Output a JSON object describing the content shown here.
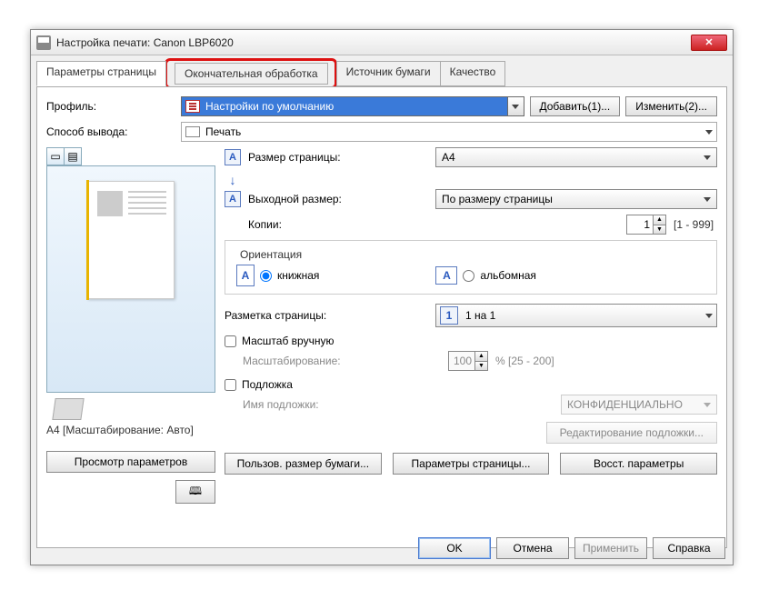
{
  "title": "Настройка печати: Canon LBP6020",
  "tabs": [
    "Параметры страницы",
    "Окончательная обработка",
    "Источник бумаги",
    "Качество"
  ],
  "profile": {
    "label": "Профиль:",
    "value": "Настройки по умолчанию",
    "add": "Добавить(1)...",
    "edit": "Изменить(2)..."
  },
  "output": {
    "label": "Способ вывода:",
    "value": "Печать"
  },
  "page_size": {
    "label": "Размер страницы:",
    "value": "A4"
  },
  "output_size": {
    "label": "Выходной размер:",
    "value": "По размеру страницы"
  },
  "copies": {
    "label": "Копии:",
    "value": "1",
    "range": "[1 - 999]"
  },
  "orientation": {
    "legend": "Ориентация",
    "portrait": "книжная",
    "landscape": "альбомная"
  },
  "layout": {
    "label": "Разметка страницы:",
    "value": "1 на 1"
  },
  "manual_scale": {
    "label": "Масштаб вручную",
    "scaling_label": "Масштабирование:",
    "value": "100",
    "range": "% [25 - 200]"
  },
  "watermark": {
    "label": "Подложка",
    "name_label": "Имя подложки:",
    "value": "КОНФИДЕНЦИАЛЬНО",
    "edit": "Редактирование подложки..."
  },
  "preview": {
    "caption": "A4 [Масштабирование: Авто]",
    "view_params": "Просмотр параметров"
  },
  "bottom": {
    "custom_size": "Пользов. размер бумаги...",
    "page_params": "Параметры страницы...",
    "restore": "Восст. параметры"
  },
  "dlg": {
    "ok": "OK",
    "cancel": "Отмена",
    "apply": "Применить",
    "help": "Справка"
  }
}
